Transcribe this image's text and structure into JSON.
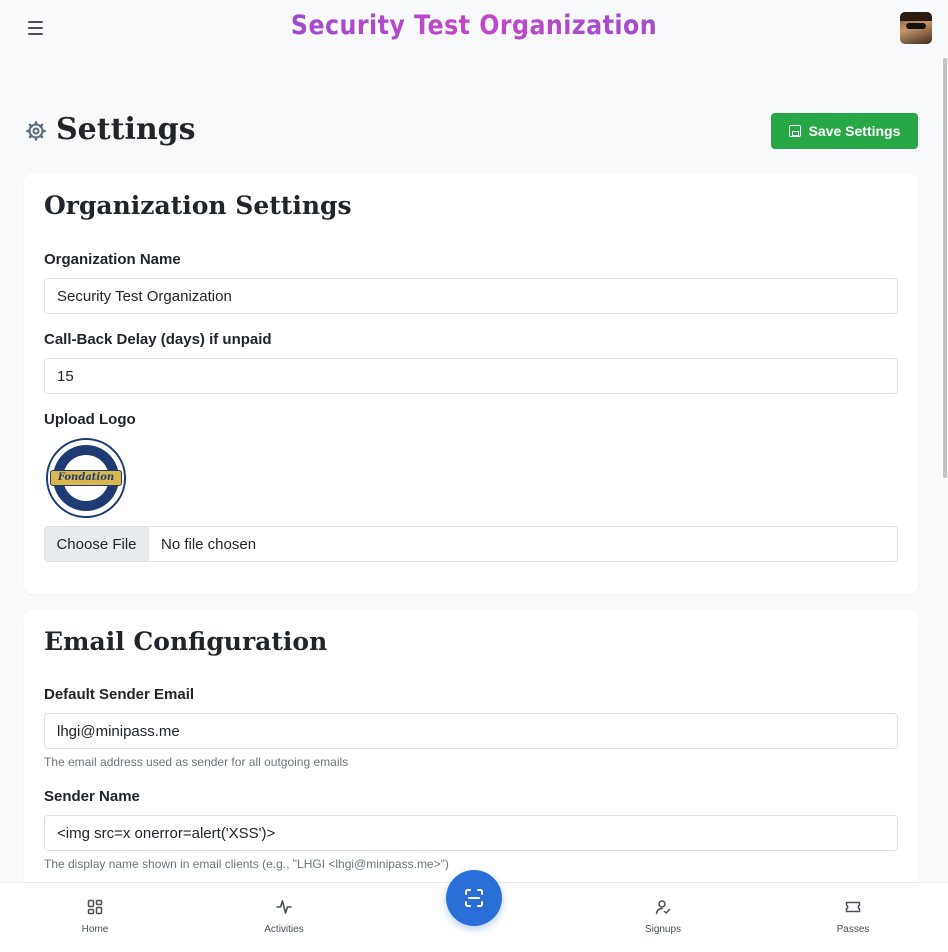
{
  "header": {
    "brand_title": "Security Test Organization",
    "menu_icon": "hamburger-icon",
    "avatar_icon": "user-avatar"
  },
  "page": {
    "title": "Settings",
    "title_icon": "gear-icon",
    "save_label": "Save Settings",
    "save_icon": "save-icon"
  },
  "organization": {
    "section_title": "Organization Settings",
    "name_label": "Organization Name",
    "name_value": "Security Test Organization",
    "callback_label": "Call-Back Delay (days) if unpaid",
    "callback_value": "15",
    "logo_label": "Upload Logo",
    "logo_text": "Fondation",
    "file_button": "Choose File",
    "file_status": "No file chosen"
  },
  "email": {
    "section_title": "Email Configuration",
    "sender_email_label": "Default Sender Email",
    "sender_email_value": "lhgi@minipass.me",
    "sender_email_help": "The email address used as sender for all outgoing emails",
    "sender_name_label": "Sender Name",
    "sender_name_value": "<img src=x onerror=alert('XSS')>",
    "sender_name_help": "The display name shown in email clients (e.g., \"LHGI <lhgi@minipass.me>\")"
  },
  "bottom_nav": {
    "home": "Home",
    "activities": "Activities",
    "signups": "Signups",
    "passes": "Passes",
    "scan_icon": "scan-icon"
  },
  "colors": {
    "primary_green": "#28a745",
    "scan_blue": "#2a6fd8",
    "brand_purple": "#7b4fd6",
    "brand_pink": "#c048c9"
  }
}
